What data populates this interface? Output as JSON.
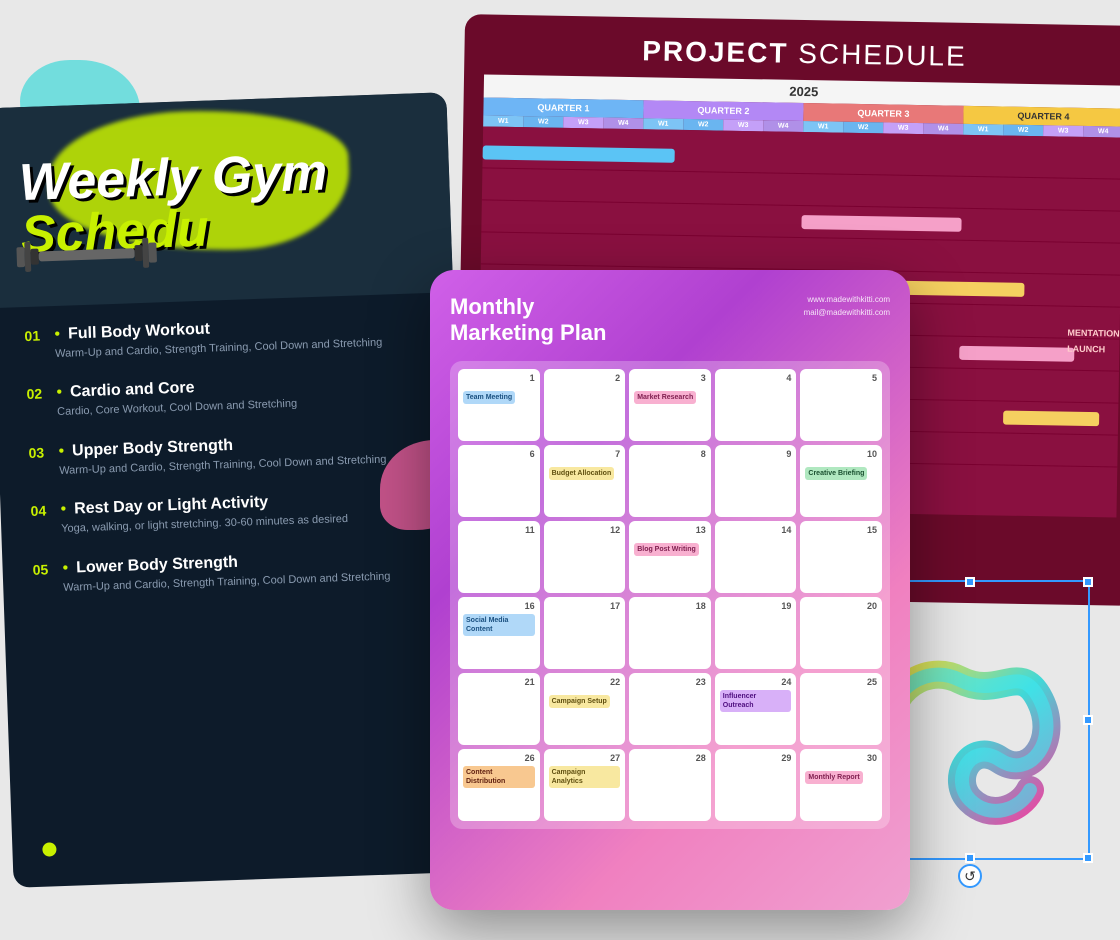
{
  "scene": {
    "background": "#e8e8e8"
  },
  "gym_card": {
    "title_line1": "Weekly Gym",
    "title_line2": "Schedu",
    "items": [
      {
        "num": "01",
        "title": "Full Body Workout",
        "desc": "Warm-Up and Cardio, Strength Training, Cool Down and Stretching"
      },
      {
        "num": "02",
        "title": "Cardio and Core",
        "desc": "Cardio, Core Workout, Cool Down and Stretching"
      },
      {
        "num": "03",
        "title": "Upper Body Strength",
        "desc": "Warm-Up and Cardio, Strength Training, Cool Down and Stretching"
      },
      {
        "num": "04",
        "title": "Rest Day or Light Activity",
        "desc": "Yoga, walking, or light stretching. 30-60 minutes as desired"
      },
      {
        "num": "05",
        "title": "Lower Body Strength",
        "desc": "Warm-Up and Cardio, Strength Training, Cool Down and Stretching"
      }
    ]
  },
  "project_card": {
    "title_bold": "PROJECT",
    "title_light": " SCHEDULE",
    "year": "2025",
    "quarters": [
      "QUARTER 1",
      "QUARTER 2",
      "QUARTER 3",
      "QUARTER 4"
    ],
    "weeks": [
      "W1",
      "W2",
      "W3",
      "W4",
      "W1",
      "W2",
      "W3",
      "W4",
      "W1",
      "W2",
      "W3",
      "W4",
      "W1",
      "W2",
      "W3",
      "W4"
    ]
  },
  "marketing_card": {
    "title_line1": "Monthly",
    "title_line2": "Marketing Plan",
    "website": "www.madewithkitti.com",
    "email": "mail@madewithkitti.com",
    "calendar": {
      "cells": [
        {
          "num": "1",
          "tag": "Team Meeting",
          "tag_class": "tag-blue"
        },
        {
          "num": "2",
          "tag": "",
          "tag_class": ""
        },
        {
          "num": "3",
          "tag": "Market Research",
          "tag_class": "tag-pink"
        },
        {
          "num": "4",
          "tag": "",
          "tag_class": ""
        },
        {
          "num": "5",
          "tag": "",
          "tag_class": ""
        },
        {
          "num": "6",
          "tag": "",
          "tag_class": ""
        },
        {
          "num": "7",
          "tag": "Budget Allocation",
          "tag_class": "tag-yellow"
        },
        {
          "num": "8",
          "tag": "",
          "tag_class": ""
        },
        {
          "num": "9",
          "tag": "",
          "tag_class": ""
        },
        {
          "num": "10",
          "tag": "Creative Briefing",
          "tag_class": "tag-green"
        },
        {
          "num": "11",
          "tag": "",
          "tag_class": ""
        },
        {
          "num": "12",
          "tag": "",
          "tag_class": ""
        },
        {
          "num": "13",
          "tag": "Blog Post Writing",
          "tag_class": "tag-pink"
        },
        {
          "num": "14",
          "tag": "",
          "tag_class": ""
        },
        {
          "num": "15",
          "tag": "",
          "tag_class": ""
        },
        {
          "num": "16",
          "tag": "Social Media Content",
          "tag_class": "tag-blue"
        },
        {
          "num": "17",
          "tag": "",
          "tag_class": ""
        },
        {
          "num": "18",
          "tag": "",
          "tag_class": ""
        },
        {
          "num": "19",
          "tag": "",
          "tag_class": ""
        },
        {
          "num": "20",
          "tag": "",
          "tag_class": ""
        },
        {
          "num": "21",
          "tag": "",
          "tag_class": ""
        },
        {
          "num": "22",
          "tag": "Campaign Setup",
          "tag_class": "tag-yellow"
        },
        {
          "num": "23",
          "tag": "",
          "tag_class": ""
        },
        {
          "num": "24",
          "tag": "Influencer Outreach",
          "tag_class": "tag-purple"
        },
        {
          "num": "25",
          "tag": "",
          "tag_class": ""
        },
        {
          "num": "26",
          "tag": "Content Distribution",
          "tag_class": "tag-orange"
        },
        {
          "num": "27",
          "tag": "Campaign Analytics",
          "tag_class": "tag-yellow"
        },
        {
          "num": "28",
          "tag": "",
          "tag_class": ""
        },
        {
          "num": "29",
          "tag": "",
          "tag_class": ""
        },
        {
          "num": "30",
          "tag": "Monthly Report",
          "tag_class": "tag-pink"
        }
      ]
    }
  },
  "selection_box": {
    "rotate_icon": "↺"
  }
}
